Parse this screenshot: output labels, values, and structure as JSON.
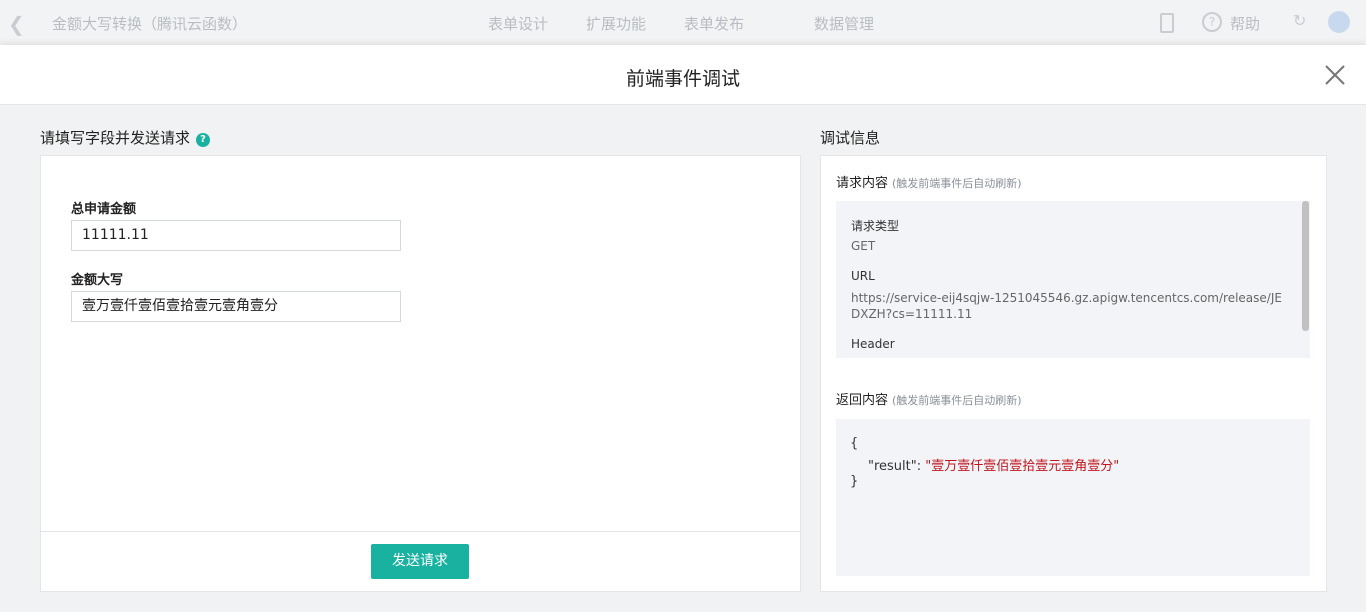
{
  "app": {
    "title": "金额大写转换（腾讯云函数）",
    "nav": [
      "表单设计",
      "扩展功能",
      "表单发布",
      "数据管理"
    ],
    "help_label": "帮助"
  },
  "modal": {
    "title": "前端事件调试"
  },
  "form": {
    "section_title": "请填写字段并发送请求",
    "fields": [
      {
        "label": "总申请金额",
        "value": "11111.11"
      },
      {
        "label": "金额大写",
        "value": "壹万壹仟壹佰壹拾壹元壹角壹分"
      }
    ],
    "send_label": "发送请求"
  },
  "debug": {
    "section_title": "调试信息",
    "request": {
      "title": "请求内容",
      "hint": "(触发前端事件后自动刷新)",
      "type_label": "请求类型",
      "type_value": "GET",
      "url_label": "URL",
      "url_value": "https://service-eij4sqjw-1251045546.gz.apigw.tencentcs.com/release/JEDXZH?cs=11111.11",
      "header_label": "Header"
    },
    "response": {
      "title": "返回内容",
      "hint": "(触发前端事件后自动刷新)",
      "open_brace": "{",
      "key": "\"result\":",
      "value": "\"壹万壹仟壹佰壹拾壹元壹角壹分\"",
      "close_brace": "}"
    }
  },
  "colors": {
    "accent": "#19b2a0",
    "json_string": "#c0151e"
  }
}
